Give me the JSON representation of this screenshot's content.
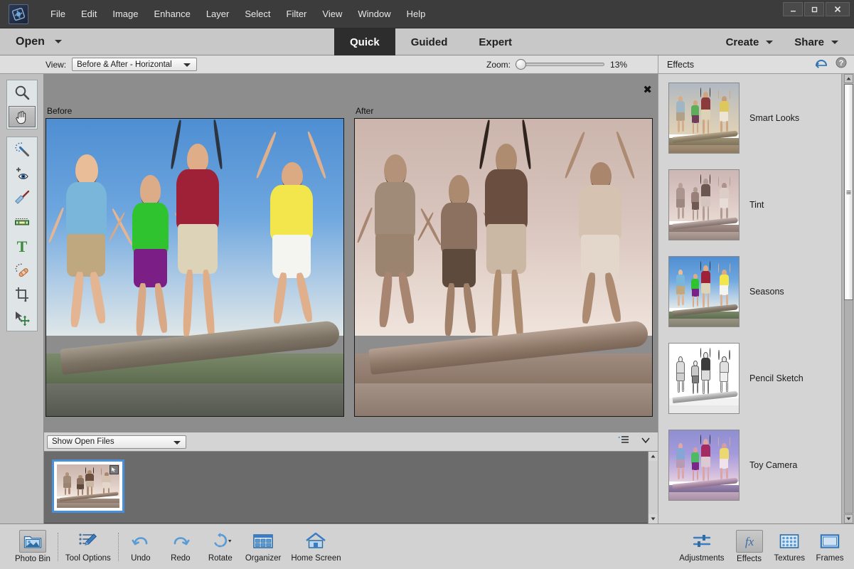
{
  "app": {
    "logo_icon": "photoshop-elements-logo",
    "window_controls": {
      "minimize": "–",
      "maximize": "⬜",
      "close": "✕"
    }
  },
  "menubar": {
    "items": [
      "File",
      "Edit",
      "Image",
      "Enhance",
      "Layer",
      "Select",
      "Filter",
      "View",
      "Window",
      "Help"
    ]
  },
  "modebar": {
    "open_label": "Open",
    "modes": [
      {
        "label": "Quick",
        "active": true
      },
      {
        "label": "Guided",
        "active": false
      },
      {
        "label": "Expert",
        "active": false
      }
    ],
    "create_label": "Create",
    "share_label": "Share"
  },
  "optionsbar": {
    "view_label": "View:",
    "view_value": "Before & After - Horizontal",
    "zoom_label": "Zoom:",
    "zoom_value": "13%",
    "zoom_slider_percent": 0
  },
  "panel": {
    "title": "Effects",
    "reset_icon": "undo-arc-icon",
    "help_icon": "help-circle-icon"
  },
  "toolbar": {
    "group1": [
      {
        "name": "zoom-tool",
        "icon": "magnifier-icon",
        "active": false
      },
      {
        "name": "hand-tool",
        "icon": "hand-icon",
        "active": true
      }
    ],
    "group2": [
      {
        "name": "quick-selection-tool",
        "icon": "magic-wand-icon",
        "active": false
      },
      {
        "name": "red-eye-removal-tool",
        "icon": "eye-plus-icon",
        "active": false
      },
      {
        "name": "whiten-teeth-tool",
        "icon": "toothbrush-icon",
        "active": false
      },
      {
        "name": "straighten-tool",
        "icon": "level-icon",
        "active": false
      },
      {
        "name": "type-tool",
        "icon": "text-t-icon",
        "active": false
      },
      {
        "name": "spot-healing-brush-tool",
        "icon": "bandage-icon",
        "active": false
      },
      {
        "name": "crop-tool",
        "icon": "crop-icon",
        "active": false
      },
      {
        "name": "move-tool",
        "icon": "move-arrows-icon",
        "active": false
      }
    ]
  },
  "canvas": {
    "close_label": "✖",
    "before_label": "Before",
    "after_label": "After"
  },
  "photobin": {
    "filter_value": "Show Open Files",
    "list_icon": "list-options-icon",
    "chevron_icon": "chevron-down-icon",
    "thumb_badge_icon": "cursor-badge-icon"
  },
  "effects": {
    "items": [
      {
        "label": "Smart Looks",
        "style": "smartlooks"
      },
      {
        "label": "Tint",
        "style": "tint"
      },
      {
        "label": "Seasons",
        "style": "seasons"
      },
      {
        "label": "Pencil Sketch",
        "style": "pencil"
      },
      {
        "label": "Toy Camera",
        "style": "toycamera"
      }
    ]
  },
  "taskbar": {
    "left": [
      {
        "label": "Photo Bin",
        "icon": "photo-bin-icon",
        "active": true
      },
      {
        "label": "Tool Options",
        "icon": "tool-options-icon",
        "active": false
      },
      {
        "label": "Undo",
        "icon": "undo-arrow-icon",
        "active": false
      },
      {
        "label": "Redo",
        "icon": "redo-arrow-icon",
        "active": false
      },
      {
        "label": "Rotate",
        "icon": "rotate-icon",
        "active": false
      },
      {
        "label": "Organizer",
        "icon": "organizer-grid-icon",
        "active": false
      },
      {
        "label": "Home Screen",
        "icon": "home-icon",
        "active": false
      }
    ],
    "right": [
      {
        "label": "Adjustments",
        "icon": "sliders-icon",
        "active": false
      },
      {
        "label": "Effects",
        "icon": "fx-icon",
        "active": true
      },
      {
        "label": "Textures",
        "icon": "textures-grid-icon",
        "active": false
      },
      {
        "label": "Frames",
        "icon": "frame-icon",
        "active": false
      }
    ]
  },
  "colors": {
    "titlebar_bg": "#3c3c3c",
    "modebar_bg": "#c8c8c8",
    "active_tab_bg": "#2d2d2d",
    "canvas_bg": "#8d8d8d",
    "panel_bg": "#d4d4d4",
    "accent_blue": "#4a90d9"
  }
}
